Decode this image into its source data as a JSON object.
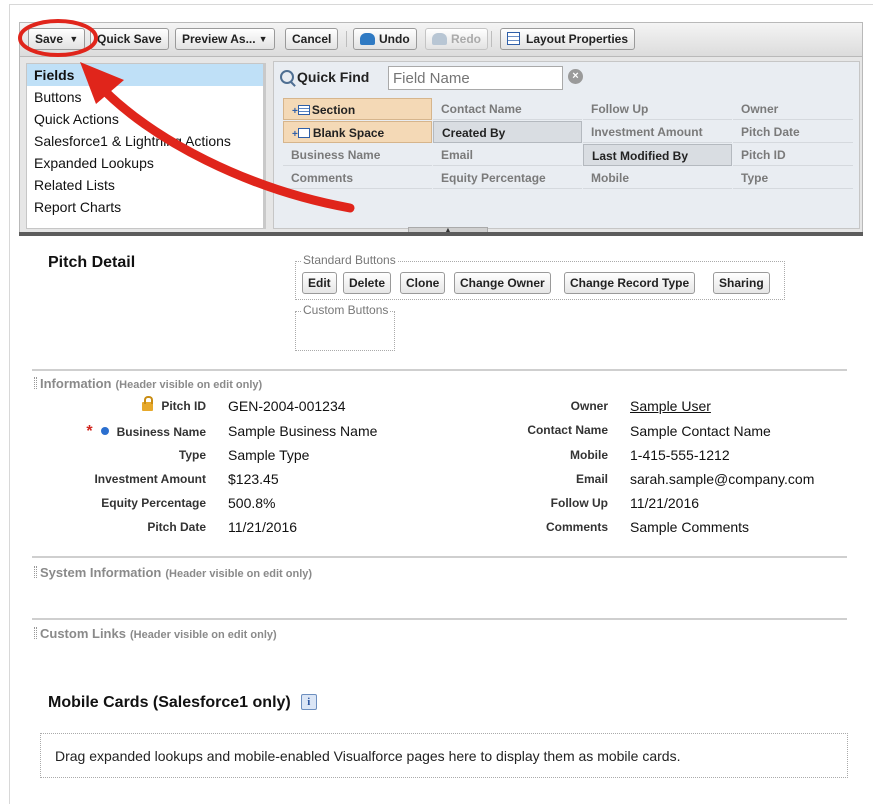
{
  "toolbar": {
    "save": "Save",
    "quick_save": "Quick Save",
    "preview_as": "Preview As...",
    "cancel": "Cancel",
    "undo": "Undo",
    "redo": "Redo",
    "layout_properties": "Layout Properties"
  },
  "palette": {
    "categories": [
      "Fields",
      "Buttons",
      "Quick Actions",
      "Salesforce1 & Lightning Actions",
      "Expanded Lookups",
      "Related Lists",
      "Report Charts"
    ],
    "selected_category": "Fields",
    "quick_find": {
      "label": "Quick Find",
      "placeholder": "Field Name",
      "value": ""
    },
    "fields": [
      [
        "Section",
        "Contact Name",
        "Follow Up",
        "Owner"
      ],
      [
        "Blank Space",
        "Created By",
        "Investment Amount",
        "Pitch Date"
      ],
      [
        "Business Name",
        "Email",
        "Last Modified By",
        "Pitch ID"
      ],
      [
        "Comments",
        "Equity Percentage",
        "Mobile",
        "Type"
      ]
    ]
  },
  "pitch_detail": {
    "title": "Pitch Detail",
    "standard_buttons_label": "Standard Buttons",
    "standard_buttons": [
      "Edit",
      "Delete",
      "Clone",
      "Change Owner",
      "Change Record Type",
      "Sharing"
    ],
    "custom_buttons_label": "Custom Buttons"
  },
  "information": {
    "title": "Information",
    "note": "(Header visible on edit only)",
    "left_fields": [
      {
        "label": "Pitch ID",
        "value": "GEN-2004-001234"
      },
      {
        "label": "Business Name",
        "value": "Sample Business Name"
      },
      {
        "label": "Type",
        "value": "Sample Type"
      },
      {
        "label": "Investment Amount",
        "value": "$123.45"
      },
      {
        "label": "Equity Percentage",
        "value": "500.8%"
      },
      {
        "label": "Pitch Date",
        "value": "11/21/2016"
      }
    ],
    "right_fields": [
      {
        "label": "Owner",
        "value": "Sample User"
      },
      {
        "label": "Contact Name",
        "value": "Sample Contact Name"
      },
      {
        "label": "Mobile",
        "value": "1-415-555-1212"
      },
      {
        "label": "Email",
        "value": "sarah.sample@company.com"
      },
      {
        "label": "Follow Up",
        "value": "11/21/2016"
      },
      {
        "label": "Comments",
        "value": "Sample Comments"
      }
    ]
  },
  "system_information": {
    "title": "System Information",
    "note": "(Header visible on edit only)"
  },
  "custom_links": {
    "title": "Custom Links",
    "note": "(Header visible on edit only)"
  },
  "mobile_cards": {
    "title": "Mobile Cards (Salesforce1 only)",
    "info_icon": "i",
    "drop_text": "Drag expanded lookups and mobile-enabled Visualforce pages here to display them as mobile cards."
  },
  "colors": {
    "annotation": "#e0251b",
    "selected_category": "#bfe0f7",
    "special_field": "#f4d9b6",
    "used_field": "#d9dde2"
  }
}
